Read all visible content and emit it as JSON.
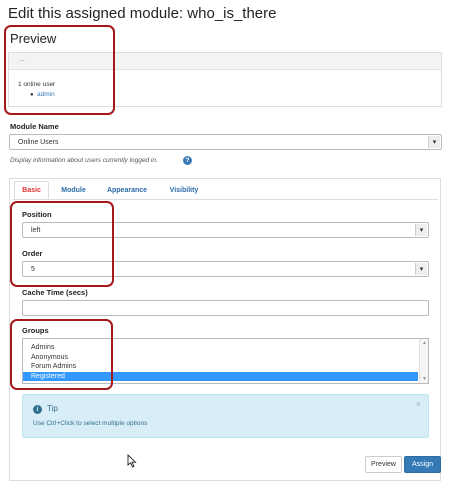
{
  "page": {
    "title": "Edit this assigned module: who_is_there"
  },
  "preview": {
    "title": "Preview",
    "header_text": "...",
    "online_count": "1 online user",
    "users": [
      "admin"
    ]
  },
  "module_name": {
    "label": "Module Name",
    "value": "Online Users",
    "description": "Display information about users currently logged in."
  },
  "tabs": [
    {
      "label": "Basic",
      "active": true
    },
    {
      "label": "Module",
      "active": false
    },
    {
      "label": "Appearance",
      "active": false
    },
    {
      "label": "Visibility",
      "active": false
    }
  ],
  "basic": {
    "position": {
      "label": "Position",
      "value": "left"
    },
    "order": {
      "label": "Order",
      "value": "5"
    },
    "cache_time": {
      "label": "Cache Time (secs)",
      "value": ""
    },
    "groups": {
      "label": "Groups",
      "options": [
        "Admins",
        "Anonymous",
        "Forum Admins",
        "Registered"
      ],
      "selected": "Registered"
    }
  },
  "tip": {
    "title": "Tip",
    "text": "Use Ctrl+Click to select multiple options",
    "close": "×"
  },
  "actions": {
    "preview_label": "Preview",
    "assign_label": "Assign"
  },
  "icons": {
    "help": "question-circle-icon",
    "info": "info-circle-icon",
    "dropdown": "caret-down-icon",
    "cursor": "mouse-pointer-icon"
  },
  "colors": {
    "link": "#337ab7",
    "active_tab": "#dd3333",
    "annotation": "#a5191c",
    "tip_bg": "#d9edf7",
    "selected_option": "#3399ff"
  }
}
